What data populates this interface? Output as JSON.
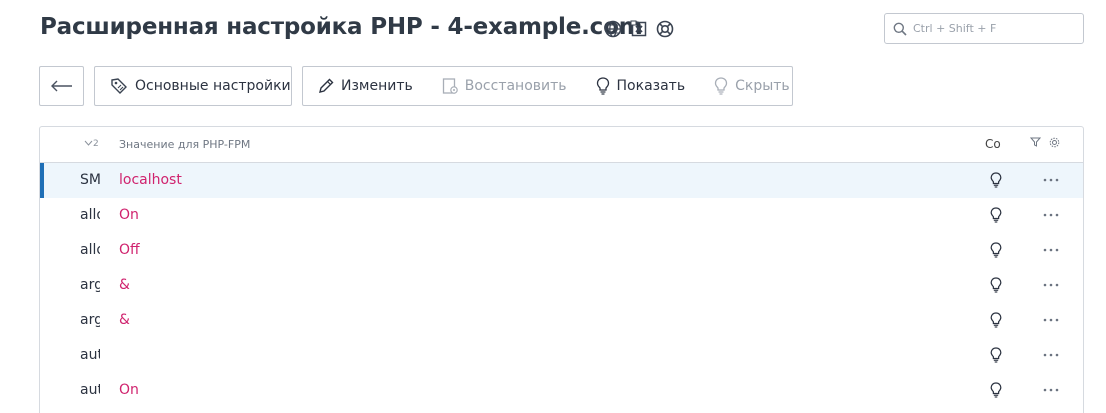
{
  "page": {
    "title": "Расширенная настройка PHP - 4-example.com"
  },
  "title_icons": [
    "globe-icon",
    "php-x-icon",
    "lifebuoy-icon"
  ],
  "search": {
    "placeholder": "Ctrl + Shift + F"
  },
  "toolbar": {
    "back_icon": "arrow-left-icon",
    "basic_settings": "Основные настройки",
    "edit": "Изменить",
    "restore": "Восстановить",
    "show": "Показать",
    "hide": "Скрыть"
  },
  "table": {
    "sort_indicator": "2",
    "columns": {
      "value": "Значение для PHP-FPM",
      "co": "Co"
    },
    "rows": [
      {
        "name": "SMTP",
        "value": "localhost",
        "active": true
      },
      {
        "name": "allow_url_fopen",
        "value": "On"
      },
      {
        "name": "allow_url_include",
        "value": "Off"
      },
      {
        "name": "arg_separator.input",
        "value": "&"
      },
      {
        "name": "arg_separator.output",
        "value": "&"
      },
      {
        "name": "auto_append_file",
        "value": ""
      },
      {
        "name": "auto_detect_line_endings",
        "value": "On"
      }
    ]
  },
  "colors": {
    "accent": "#1f6fb6",
    "value_text": "#d0236e",
    "active_row": "#eef6fc"
  }
}
